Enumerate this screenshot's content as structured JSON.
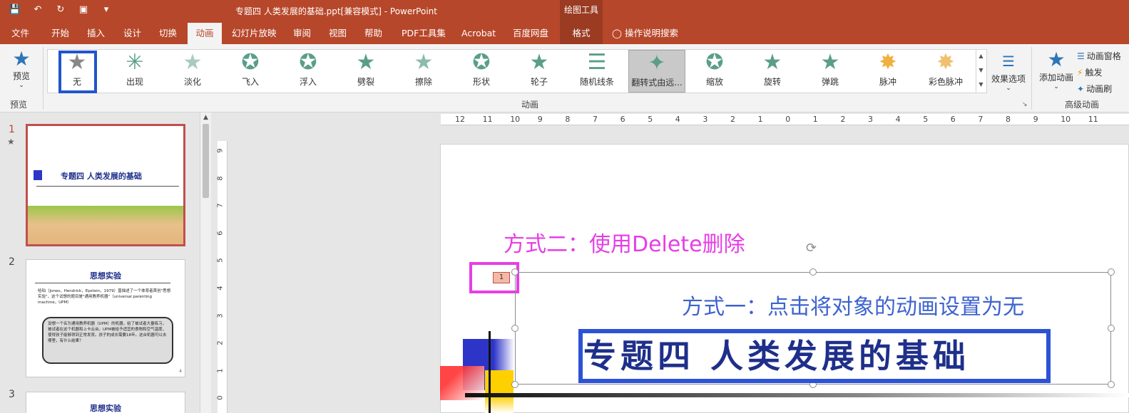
{
  "title_bar": {
    "document_title": "专题四 人类发展的基础.ppt[兼容模式]  -  PowerPoint",
    "context_group": "绘图工具",
    "qat_icons": [
      "save-icon",
      "undo-icon",
      "redo-icon",
      "present-icon",
      "customize-icon"
    ]
  },
  "tabs": [
    {
      "label": "文件"
    },
    {
      "label": "开始"
    },
    {
      "label": "插入"
    },
    {
      "label": "设计"
    },
    {
      "label": "切换"
    },
    {
      "label": "动画"
    },
    {
      "label": "幻灯片放映"
    },
    {
      "label": "审阅"
    },
    {
      "label": "视图"
    },
    {
      "label": "帮助"
    },
    {
      "label": "PDF工具集"
    },
    {
      "label": "Acrobat"
    },
    {
      "label": "百度网盘"
    },
    {
      "label": "格式"
    }
  ],
  "tell_me": "操作说明搜索",
  "ribbon": {
    "preview_label": "预览",
    "preview_group": "预览",
    "animation_group": "动画",
    "advanced_group": "高级动画",
    "animations": [
      {
        "label": "无"
      },
      {
        "label": "出现"
      },
      {
        "label": "淡化"
      },
      {
        "label": "飞入"
      },
      {
        "label": "浮入"
      },
      {
        "label": "劈裂"
      },
      {
        "label": "擦除"
      },
      {
        "label": "形状"
      },
      {
        "label": "轮子"
      },
      {
        "label": "随机线条"
      },
      {
        "label": "翻转式由远..."
      },
      {
        "label": "缩放"
      },
      {
        "label": "旋转"
      },
      {
        "label": "弹跳"
      },
      {
        "label": "脉冲"
      },
      {
        "label": "彩色脉冲"
      }
    ],
    "effect_options": "效果选项",
    "add_animation": "添加动画",
    "animation_pane": "动画窗格",
    "trigger": "触发",
    "animation_painter": "动画刷"
  },
  "slides_panel": {
    "slide1_number": "1",
    "slide1_title": "专题四  人类发展的基础",
    "slide2_number": "2",
    "slide2_title": "思想实验",
    "slide2_bullet": "哈珀（Jones，Hendrick，Epstein，1979）曾描述了一个体育者首创\"思想实验\"，这个试想的题目是\"通用教养机器\"（universal parenting machine，UPM）",
    "slide2_box": "设想一个名为通用教养机器（UPM）的机器，给了被试者大量练习，被试者在这个机器和上卡云台。UPM被给予适宜的食物和空气温度，使得孩子能够得到正常发育。孩子的成长需要18年。这台机器可以去哪里，有什么结果？",
    "slide2_page": "4",
    "slide3_number": "3",
    "slide3_title": "思想实验"
  },
  "h_ruler_labels": [
    "12",
    "11",
    "10",
    "9",
    "8",
    "7",
    "6",
    "5",
    "4",
    "3",
    "2",
    "1",
    "0",
    "1",
    "2",
    "3",
    "4",
    "5",
    "6",
    "7",
    "8",
    "9",
    "10",
    "11"
  ],
  "v_ruler_labels": [
    "9",
    "8",
    "7",
    "6",
    "5",
    "4",
    "3",
    "2",
    "1",
    "0"
  ],
  "slide": {
    "annotation_method2": "方式二：使用Delete删除",
    "annotation_method1": "方式一：点击将对象的动画设置为无",
    "animation_tag": "1",
    "title": "专题四  人类发展的基础"
  }
}
